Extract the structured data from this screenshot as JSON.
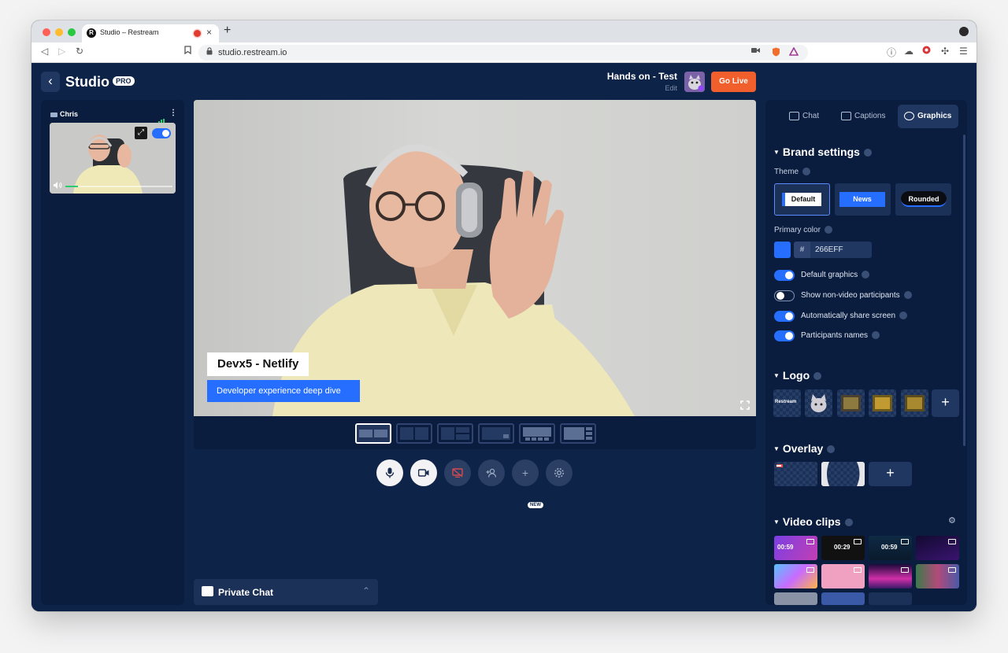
{
  "browser": {
    "tab_title": "Studio – Restream",
    "favicon_letter": "R",
    "new_tab": "+",
    "close": "×",
    "url": "studio.restream.io"
  },
  "header": {
    "back_label": "‹",
    "studio_title": "Studio",
    "pro_badge": "PRO",
    "stream_title": "Hands on - Test",
    "edit_label": "Edit",
    "go_live": "Go Live"
  },
  "left_panel": {
    "participant_name": "Chris",
    "kebab": "⋮"
  },
  "stage": {
    "lower_third_name": "Devx5 - Netlify",
    "lower_third_subtitle": "Developer experience deep dive",
    "layouts": [
      "layout-1",
      "layout-2",
      "layout-3",
      "layout-4",
      "layout-5",
      "layout-6"
    ],
    "active_layout": 0
  },
  "controls": {
    "new_badge": "NEW",
    "buttons": [
      "mic",
      "camera",
      "share-screen",
      "invite-guest",
      "add",
      "settings"
    ]
  },
  "private_chat": {
    "label": "Private Chat",
    "chevron": "⌃"
  },
  "right_panel": {
    "tabs": [
      {
        "label": "Chat",
        "icon": "chat-icon"
      },
      {
        "label": "Captions",
        "icon": "captions-icon"
      },
      {
        "label": "Graphics",
        "icon": "palette-icon"
      }
    ],
    "active_tab": "Graphics",
    "brand_settings": {
      "title": "Brand settings",
      "theme_label": "Theme",
      "themes": [
        "Default",
        "News",
        "Rounded"
      ],
      "selected_theme": "Default",
      "primary_color_label": "Primary color",
      "hash": "#",
      "primary_color_value": "266EFF",
      "toggles": [
        {
          "label": "Default graphics",
          "on": true
        },
        {
          "label": "Show non-video participants",
          "on": false
        },
        {
          "label": "Automatically share screen",
          "on": true
        },
        {
          "label": "Participants names",
          "on": true
        }
      ]
    },
    "logo": {
      "title": "Logo",
      "restream_logo_text": "Restream",
      "add": "+"
    },
    "overlay": {
      "title": "Overlay",
      "add": "+"
    },
    "video_clips": {
      "title": "Video clips",
      "durations": [
        "00:59",
        "00:29",
        "00:59"
      ]
    }
  },
  "colors": {
    "primary": "#266EFF",
    "go_live": "#F1602C",
    "app_bg": "#0E2348"
  }
}
